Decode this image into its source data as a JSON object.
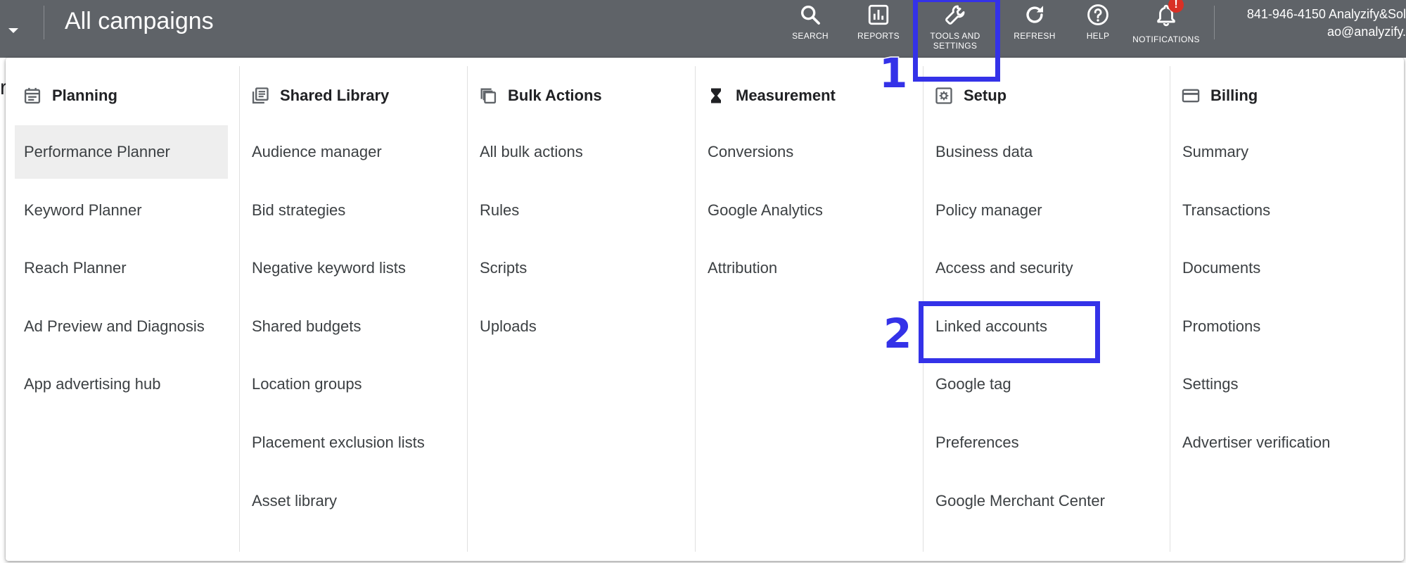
{
  "header": {
    "title": "All campaigns",
    "toolbar": [
      {
        "key": "search",
        "label": "SEARCH",
        "icon": "search-icon"
      },
      {
        "key": "reports",
        "label": "REPORTS",
        "icon": "reports-icon"
      },
      {
        "key": "tools",
        "label": "TOOLS AND SETTINGS",
        "label_line1": "TOOLS AND",
        "label_line2": "SETTINGS",
        "icon": "wrench-icon"
      },
      {
        "key": "refresh",
        "label": "REFRESH",
        "icon": "refresh-icon"
      },
      {
        "key": "help",
        "label": "HELP",
        "icon": "help-icon"
      },
      {
        "key": "notifications",
        "label": "NOTIFICATIONS",
        "icon": "bell-icon",
        "badge": "!"
      }
    ],
    "account": {
      "line1": "841-946-4150 Analyzify&Sol",
      "line2": "ao@analyzify."
    },
    "bar_color": "#5f6368"
  },
  "background_peek": "r",
  "menu": {
    "columns": [
      {
        "heading": "Planning",
        "icon": "calendar-icon",
        "items": [
          "Performance Planner",
          "Keyword Planner",
          "Reach Planner",
          "Ad Preview and Diagnosis",
          "App advertising hub"
        ],
        "active_index": 0
      },
      {
        "heading": "Shared Library",
        "icon": "library-icon",
        "items": [
          "Audience manager",
          "Bid strategies",
          "Negative keyword lists",
          "Shared budgets",
          "Location groups",
          "Placement exclusion lists",
          "Asset library"
        ]
      },
      {
        "heading": "Bulk Actions",
        "icon": "copy-icon",
        "items": [
          "All bulk actions",
          "Rules",
          "Scripts",
          "Uploads"
        ]
      },
      {
        "heading": "Measurement",
        "icon": "hourglass-icon",
        "items": [
          "Conversions",
          "Google Analytics",
          "Attribution"
        ]
      },
      {
        "heading": "Setup",
        "icon": "gear-box-icon",
        "items": [
          "Business data",
          "Policy manager",
          "Access and security",
          "Linked accounts",
          "Google tag",
          "Preferences",
          "Google Merchant Center"
        ]
      },
      {
        "heading": "Billing",
        "icon": "credit-card-icon",
        "items": [
          "Summary",
          "Transactions",
          "Documents",
          "Promotions",
          "Settings",
          "Advertiser verification"
        ]
      }
    ]
  },
  "annotations": [
    {
      "number": "1",
      "target": "TOOLS AND SETTINGS"
    },
    {
      "number": "2",
      "target": "Linked accounts"
    }
  ],
  "annotation_color": "#3432e8"
}
